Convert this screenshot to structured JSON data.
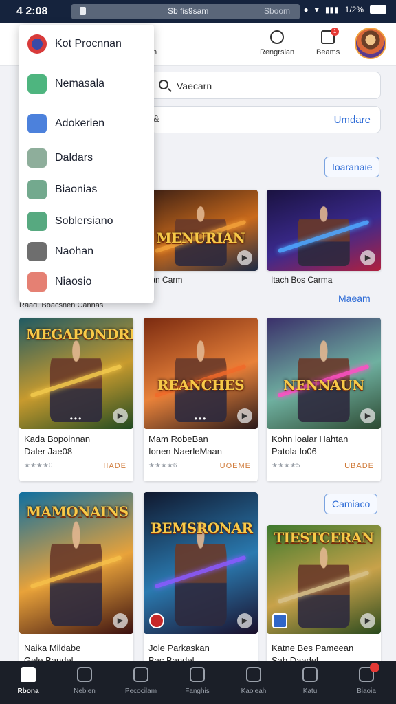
{
  "status_bar": {
    "time": "4 2:08",
    "url": "Sb fis9sam",
    "url_right": "Sboom",
    "signal": "1/2%"
  },
  "header": {
    "items": [
      {
        "label": "n"
      },
      {
        "label": "Rengrsian"
      },
      {
        "label": "Beams",
        "badge": "1"
      }
    ]
  },
  "search": {
    "value": "Vaecarn"
  },
  "row2": {
    "text": "&",
    "action": "Umdare"
  },
  "section_pill": "Ioaranaie",
  "featured": [
    {
      "art_title": "MENURIAN",
      "caption": "Ian Carm",
      "colors": [
        "#3a1e14",
        "#c96a1c",
        "#1c2a44"
      ],
      "glow": "#f2a13a"
    },
    {
      "art_title": "",
      "caption": "Itach Bos Carma",
      "colors": [
        "#1a1240",
        "#3b2a8e",
        "#b0203e"
      ],
      "glow": "#4fa8ff"
    }
  ],
  "section_label": "Raad. Boacsnen Cannas",
  "section_link": "Maeam",
  "games_row1": [
    {
      "art_title": "MEGAPONDRI",
      "name1": "Kada Bopoinnan",
      "name2": "Daler Jae08",
      "stars": "★★★★0",
      "price": "IIADE",
      "colors": [
        "#1f5a63",
        "#c79a2e",
        "#204a22"
      ],
      "glow": "#f2c94c"
    },
    {
      "art_title": "REANCHES",
      "name1": "Mam RobeBan",
      "name2": "Ionen NaerleMaan",
      "stars": "★★★★6",
      "price": "UOEME",
      "colors": [
        "#7a2a10",
        "#e8823a",
        "#2a1a1a"
      ],
      "glow": "#f06a2a"
    },
    {
      "art_title": "NENNAUN",
      "name1": "Kohn loalar Hahtan",
      "name2": "Patola Io06",
      "stars": "★★★★5",
      "price": "UBADE",
      "colors": [
        "#3a2f6a",
        "#6fb0a0",
        "#2d4a32"
      ],
      "glow": "#ff4fc4"
    }
  ],
  "section_pill2": "Camiaco",
  "games_row2": [
    {
      "art_title": "MAMONAINS",
      "name1": "Naika Mildabe",
      "name2": "Gele Bandel",
      "colors": [
        "#0f6fa0",
        "#e8a23a",
        "#3a1010"
      ],
      "glow": "#f6c04a"
    },
    {
      "art_title": "BEMSRONAR",
      "name1": "Jole Parkaskan",
      "name2": "Bac Bandel",
      "colors": [
        "#10182e",
        "#2a7ab0",
        "#1a0f2a"
      ],
      "glow": "#8a5aff"
    },
    {
      "art_title": "TIESTCERAN",
      "name1": "Katne Bes Pameean",
      "name2": "Sab Daadel",
      "colors": [
        "#3e7a2e",
        "#c8a24a",
        "#2a4a1e"
      ],
      "glow": "#d6c08a"
    }
  ],
  "bottom_nav": [
    {
      "label": "Rbona",
      "active": true
    },
    {
      "label": "Nebien"
    },
    {
      "label": "Pecocilam"
    },
    {
      "label": "Fanghis"
    },
    {
      "label": "Kaoleah"
    },
    {
      "label": "Katu"
    },
    {
      "label": "Biaoia",
      "badge": true
    }
  ],
  "menu": [
    {
      "label": "Kot Procnnan",
      "icon": "logo-icon",
      "color": "#d83a3a"
    },
    {
      "label": "Nemasala",
      "icon": "check-icon",
      "color": "#2fa868"
    },
    {
      "label": "Adokerien",
      "icon": "chat-icon",
      "color": "#2d6bd6"
    },
    {
      "label": "Daldars",
      "icon": "tag-icon",
      "color": "#7aa08a"
    },
    {
      "label": "Biaonias",
      "icon": "monitor-icon",
      "color": "#5b9a7a"
    },
    {
      "label": "Soblersiano",
      "icon": "home-icon",
      "color": "#3a9a6a"
    },
    {
      "label": "Naohan",
      "icon": "person-icon",
      "color": "#555"
    },
    {
      "label": "Niaosio",
      "icon": "heart-icon",
      "color": "#e06a5a"
    }
  ]
}
